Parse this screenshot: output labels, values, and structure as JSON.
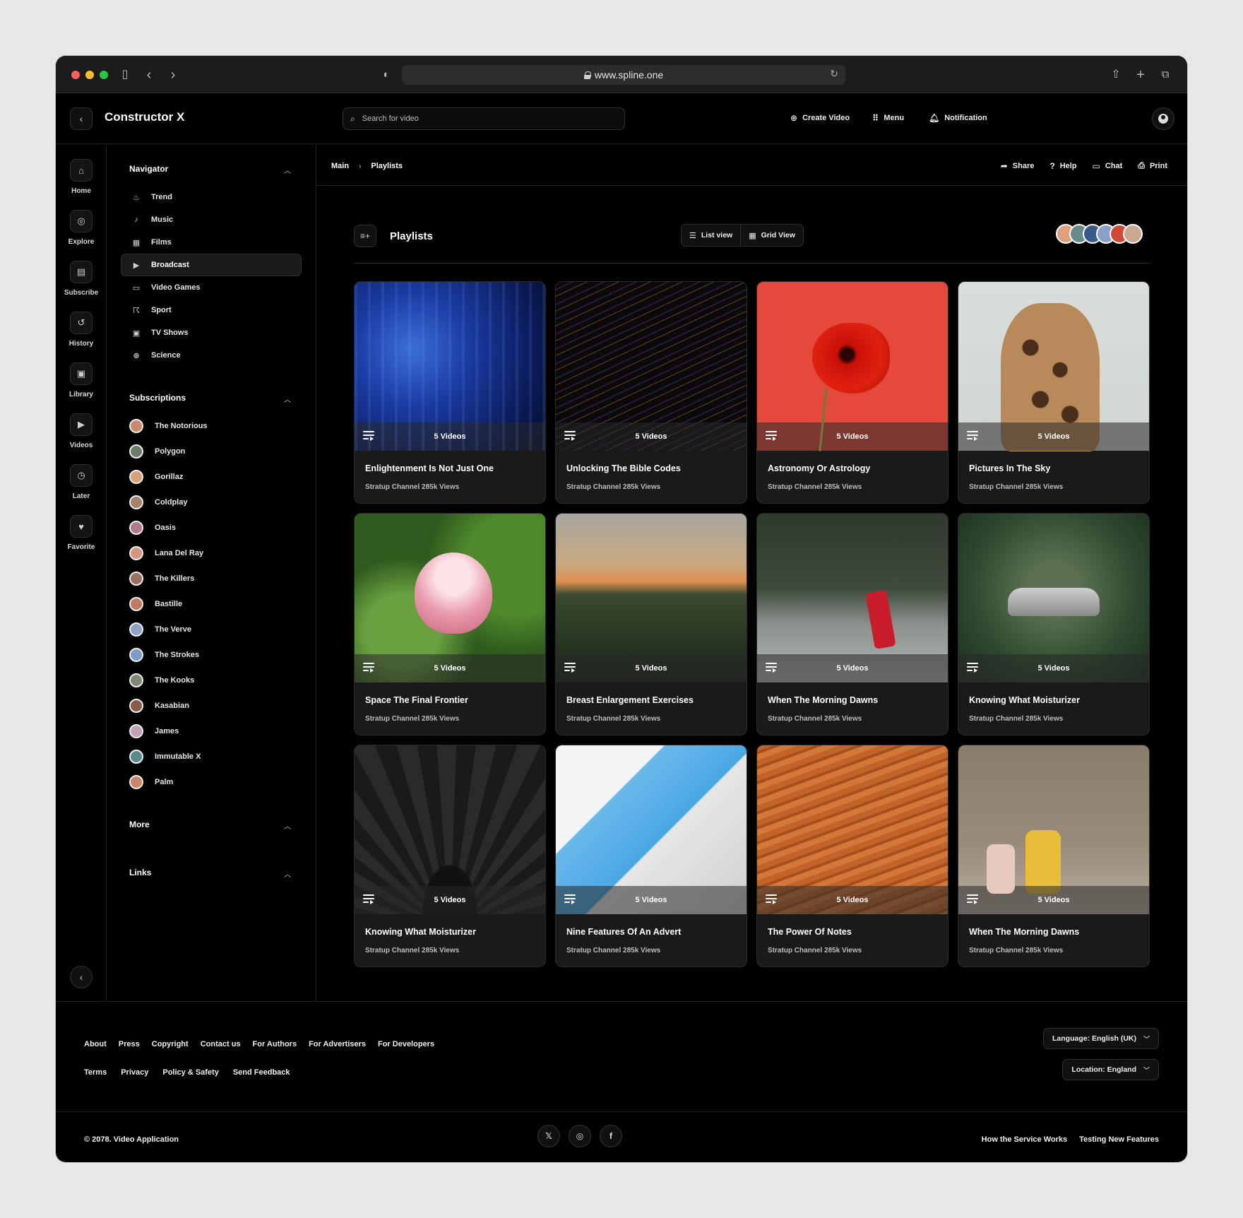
{
  "browser": {
    "url": "www.spline.one"
  },
  "app": {
    "title": "Constructor X"
  },
  "header": {
    "search_placeholder": "Search for video",
    "actions": [
      {
        "label": "Create Video",
        "icon": "plus-circle-icon"
      },
      {
        "label": "Menu",
        "icon": "grid-icon"
      },
      {
        "label": "Notification",
        "icon": "bell-icon"
      }
    ]
  },
  "rail": {
    "items": [
      {
        "label": "Home",
        "icon": "home-icon"
      },
      {
        "label": "Explore",
        "icon": "compass-icon"
      },
      {
        "label": "Subscribe",
        "icon": "subscribe-icon"
      },
      {
        "label": "History",
        "icon": "history-icon"
      },
      {
        "label": "Library",
        "icon": "library-icon"
      },
      {
        "label": "Videos",
        "icon": "video-icon"
      },
      {
        "label": "Later",
        "icon": "clock-icon"
      },
      {
        "label": "Favorite",
        "icon": "heart-icon"
      }
    ]
  },
  "navigator": {
    "title": "Navigator",
    "items": [
      {
        "label": "Trend",
        "icon": "flame-icon"
      },
      {
        "label": "Music",
        "icon": "music-note-icon"
      },
      {
        "label": "Films",
        "icon": "film-icon"
      },
      {
        "label": "Broadcast",
        "icon": "play-circle-icon",
        "active": true
      },
      {
        "label": "Video Games",
        "icon": "gamepad-icon"
      },
      {
        "label": "Sport",
        "icon": "running-icon"
      },
      {
        "label": "TV Shows",
        "icon": "tv-icon"
      },
      {
        "label": "Science",
        "icon": "atom-icon"
      }
    ]
  },
  "subscriptions": {
    "title": "Subscriptions",
    "items": [
      {
        "label": "The Notorious",
        "color": "#c98a6e"
      },
      {
        "label": "Polygon",
        "color": "#6e7c6a"
      },
      {
        "label": "Gorillaz",
        "color": "#d6a27a"
      },
      {
        "label": "Coldplay",
        "color": "#a5826a"
      },
      {
        "label": "Oasis",
        "color": "#b07a8a"
      },
      {
        "label": "Lana Del Ray",
        "color": "#d4977e"
      },
      {
        "label": "The Killers",
        "color": "#9a7060"
      },
      {
        "label": "Bastille",
        "color": "#c27a5e"
      },
      {
        "label": "The Verve",
        "color": "#8fa2c6"
      },
      {
        "label": "The Strokes",
        "color": "#7f9ac4"
      },
      {
        "label": "The Kooks",
        "color": "#7e8a74"
      },
      {
        "label": "Kasabian",
        "color": "#8a5a4a"
      },
      {
        "label": "James",
        "color": "#c4a0b8"
      },
      {
        "label": "Immutable X",
        "color": "#5a8a8a"
      },
      {
        "label": "Palm",
        "color": "#c9856a"
      }
    ]
  },
  "more": {
    "title": "More"
  },
  "links": {
    "title": "Links"
  },
  "breadcrumb": {
    "items": [
      "Main",
      "Playlists"
    ]
  },
  "main_actions": [
    {
      "label": "Share",
      "icon": "share-icon"
    },
    {
      "label": "Help",
      "icon": "help-icon"
    },
    {
      "label": "Chat",
      "icon": "chat-icon"
    },
    {
      "label": "Print",
      "icon": "printer-icon"
    }
  ],
  "playlists": {
    "title": "Playlists",
    "views": [
      {
        "label": "List view",
        "icon": "list-icon"
      },
      {
        "label": "Grid View",
        "icon": "grid-view-icon"
      }
    ],
    "avatar_colors": [
      "#e0a07e",
      "#6a8a8a",
      "#3a5a8a",
      "#8aa0c6",
      "#d04a3a",
      "#caa890"
    ],
    "cards": [
      {
        "title": "Enlightenment Is Not Just One",
        "count": "5 Videos",
        "meta": "Stratup Channel 285k Views",
        "thumb": "t1"
      },
      {
        "title": "Unlocking The Bible Codes",
        "count": "5 Videos",
        "meta": "Stratup Channel 285k Views",
        "thumb": "t2"
      },
      {
        "title": "Astronomy Or Astrology",
        "count": "5 Videos",
        "meta": "Stratup Channel 285k Views",
        "thumb": "t3"
      },
      {
        "title": "Pictures In The Sky",
        "count": "5 Videos",
        "meta": "Stratup Channel 285k Views",
        "thumb": "t4"
      },
      {
        "title": "Space The Final Frontier",
        "count": "5 Videos",
        "meta": "Stratup Channel 285k Views",
        "thumb": "t5"
      },
      {
        "title": "Breast Enlargement Exercises",
        "count": "5 Videos",
        "meta": "Stratup Channel 285k Views",
        "thumb": "t6"
      },
      {
        "title": "When The Morning Dawns",
        "count": "5 Videos",
        "meta": "Stratup Channel 285k Views",
        "thumb": "t7"
      },
      {
        "title": "Knowing What Moisturizer",
        "count": "5 Videos",
        "meta": "Stratup Channel 285k Views",
        "thumb": "t8"
      },
      {
        "title": "Knowing What Moisturizer",
        "count": "5 Videos",
        "meta": "Stratup Channel 285k Views",
        "thumb": "t9"
      },
      {
        "title": "Nine Features Of An Advert",
        "count": "5 Videos",
        "meta": "Stratup Channel 285k Views",
        "thumb": "t10"
      },
      {
        "title": "The Power Of Notes",
        "count": "5 Videos",
        "meta": "Stratup Channel 285k Views",
        "thumb": "t11"
      },
      {
        "title": "When The Morning Dawns",
        "count": "5 Videos",
        "meta": "Stratup Channel 285k Views",
        "thumb": "t12"
      }
    ]
  },
  "footer": {
    "row1": [
      "About",
      "Press",
      "Copyright",
      "Contact us",
      "For Authors",
      "For Advertisers",
      "For Developers"
    ],
    "row2": [
      "Terms",
      "Privacy",
      "Policy & Safety",
      "Send Feedback"
    ],
    "language": "Language: English (UK)",
    "location": "Location: England",
    "copyright": "© 2078. Video Application",
    "social": [
      "x-icon",
      "instagram-icon",
      "facebook-icon"
    ],
    "right_links": [
      "How the Service Works",
      "Testing New Features"
    ]
  }
}
